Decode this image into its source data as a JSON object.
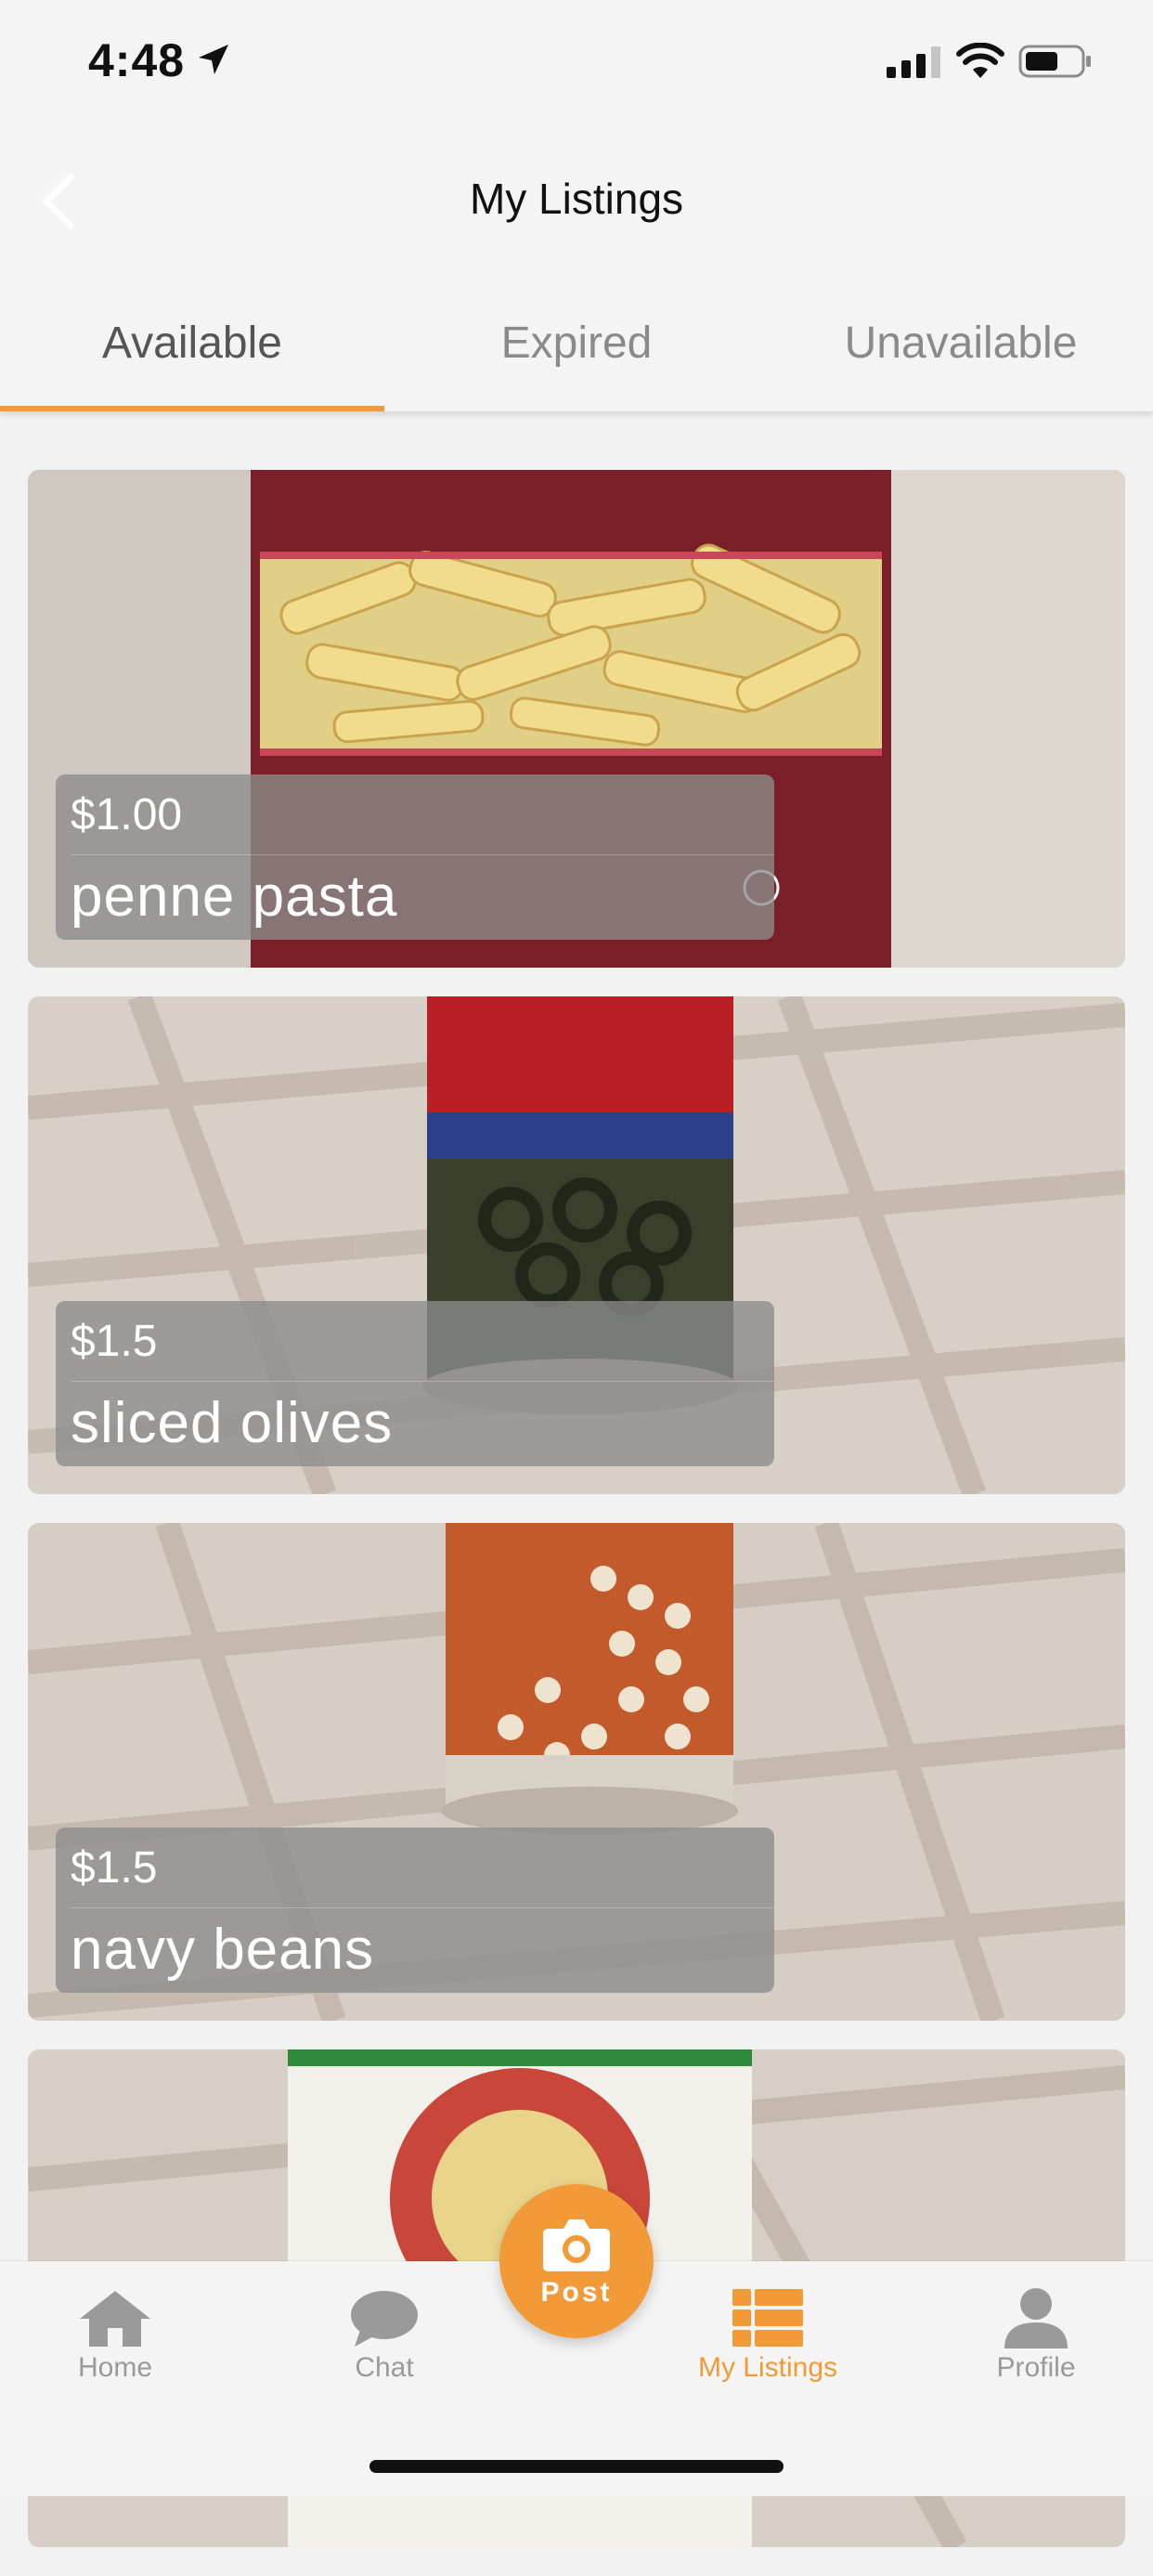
{
  "status_bar": {
    "time": "4:48"
  },
  "nav": {
    "title": "My Listings",
    "back_icon": "chevron-left-icon"
  },
  "tabs": [
    {
      "label": "Available",
      "active": true
    },
    {
      "label": "Expired",
      "active": false
    },
    {
      "label": "Unavailable",
      "active": false
    }
  ],
  "listings": [
    {
      "price": "$1.00",
      "title": "penne pasta"
    },
    {
      "price": "$1.5",
      "title": "sliced olives"
    },
    {
      "price": "$1.5",
      "title": "navy beans"
    }
  ],
  "tabbar": {
    "home": "Home",
    "chat": "Chat",
    "post": "Post",
    "my_listings": "My Listings",
    "profile": "Profile"
  },
  "colors": {
    "accent": "#f29a38",
    "inactive": "#9a9a9a"
  }
}
